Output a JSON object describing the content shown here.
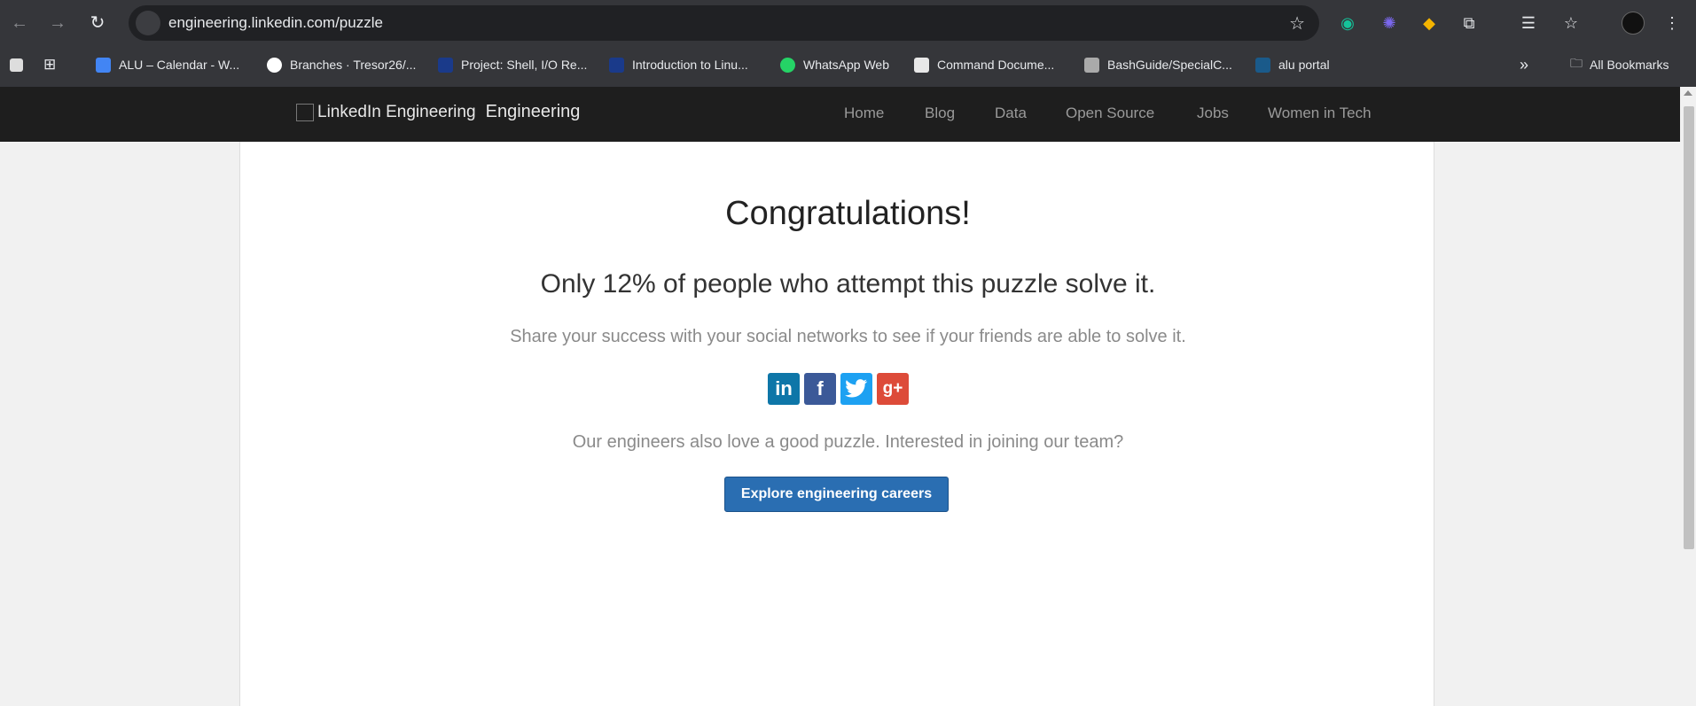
{
  "browser": {
    "url": "engineering.linkedin.com/puzzle",
    "bookmarks": [
      {
        "label": "ALU – Calendar - W...",
        "icon": "calendar-icon",
        "color": "#4285f4"
      },
      {
        "label": "Branches · Tresor26/...",
        "icon": "github-icon",
        "color": "#ffffff"
      },
      {
        "label": "Project: Shell, I/O Re...",
        "icon": "alu-icon",
        "color": "#1a3a8a"
      },
      {
        "label": "Introduction to Linu...",
        "icon": "alu-icon",
        "color": "#1a3a8a"
      },
      {
        "label": "WhatsApp Web",
        "icon": "whatsapp-icon",
        "color": "#25d366"
      },
      {
        "label": "Command Docume...",
        "icon": "doc-icon",
        "color": "#e8e8e8"
      },
      {
        "label": "BashGuide/SpecialC...",
        "icon": "image-icon",
        "color": "#aaaaaa"
      },
      {
        "label": "alu portal",
        "icon": "alu-portal-icon",
        "color": "#1a5a8a"
      }
    ],
    "all_bookmarks": "All Bookmarks"
  },
  "site": {
    "logo_alt": "LinkedIn Engineering",
    "logo_text": "Engineering",
    "nav": [
      "Home",
      "Blog",
      "Data",
      "Open Source",
      "Jobs",
      "Women in Tech"
    ]
  },
  "main": {
    "title": "Congratulations!",
    "subtitle": "Only 12% of people who attempt this puzzle solve it.",
    "share_text": "Share your success with your social networks to see if your friends are able to solve it.",
    "social": [
      {
        "name": "linkedin",
        "glyph": "in",
        "color": "#0e76a8"
      },
      {
        "name": "facebook",
        "glyph": "f",
        "color": "#3b5998"
      },
      {
        "name": "twitter",
        "glyph": "t",
        "color": "#1da1f2"
      },
      {
        "name": "google-plus",
        "glyph": "g+",
        "color": "#dd4b39"
      }
    ],
    "join_text": "Our engineers also love a good puzzle. Interested in joining our team?",
    "cta": "Explore engineering careers"
  }
}
